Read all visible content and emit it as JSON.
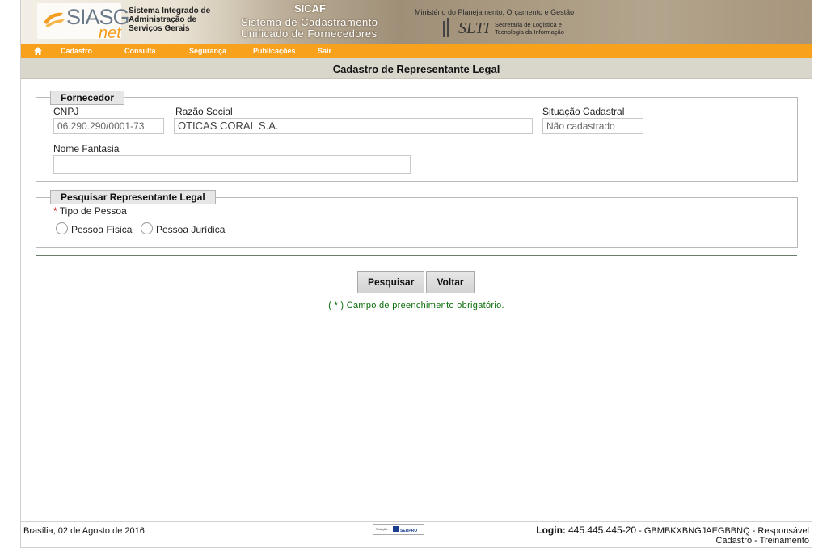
{
  "header": {
    "logo_text": "SIASG",
    "logo_suffix": "net",
    "system_name_line1": "Sistema Integrado de",
    "system_name_line2": "Administração de",
    "system_name_line3": "Serviços Gerais",
    "sicaf_title": "SICAF",
    "sicaf_line1": "Sistema de Cadastramento",
    "sicaf_line2": "Unificado de Fornecedores",
    "ministry": "Ministério do Planejamento, Orçamento e Gestão",
    "slti": "SLTI",
    "slti_sub1": "Secretaria de Logística e",
    "slti_sub2": "Tecnologia da Informação"
  },
  "nav": {
    "items": [
      "Cadastro",
      "Consulta",
      "Segurança",
      "Publicações",
      "Sair"
    ]
  },
  "page_title": "Cadastro de Representante Legal",
  "fornecedor": {
    "legend": "Fornecedor",
    "cnpj_label": "CNPJ",
    "cnpj_value": "06.290.290/0001-73",
    "razao_label": "Razão Social",
    "razao_value": "OTICAS CORAL S.A.",
    "situacao_label": "Situação Cadastral",
    "situacao_value": "Não cadastrado",
    "fantasia_label": "Nome Fantasia",
    "fantasia_value": ""
  },
  "pesquisar": {
    "legend": "Pesquisar Representante Legal",
    "required_mark": "*",
    "tipo_label": "Tipo de Pessoa",
    "option_fisica": "Pessoa Física",
    "option_juridica": "Pessoa Jurídica"
  },
  "buttons": {
    "search": "Pesquisar",
    "back": "Voltar"
  },
  "required_note": "( * ) Campo de preenchimento obrigatório.",
  "footer": {
    "date": "Brasília, 02 de Agosto de 2016",
    "solution": "Solução SERPRO",
    "login_label": "Login:",
    "login_value": "445.445.445-20",
    "login_rest": " - GBMBKXBNGJAEGBBNQ - Responsável",
    "login_line2": "Cadastro - Treinamento"
  },
  "colors": {
    "nav": "#f7a11c",
    "title_bar": "#d9d6cc",
    "note": "#0a6e0a"
  }
}
